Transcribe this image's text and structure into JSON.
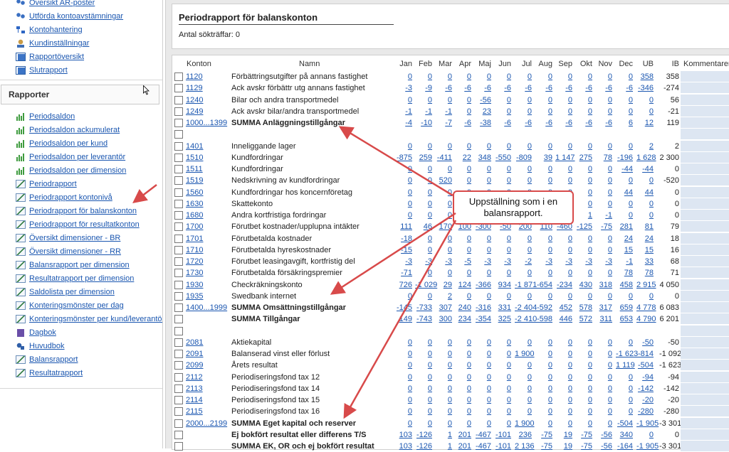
{
  "sidebar": {
    "top_links": [
      {
        "label": "Översikt AR-poster",
        "icon": "people-icon"
      },
      {
        "label": "Utförda kontoavstämningar",
        "icon": "people-icon"
      },
      {
        "label": "Kontohantering",
        "icon": "tree-icon"
      },
      {
        "label": "Kundinställningar",
        "icon": "user-icon"
      },
      {
        "label": "Rapportöversikt",
        "icon": "report-icon"
      },
      {
        "label": "Slutrapport",
        "icon": "report-icon"
      }
    ],
    "reports_heading": "Rapporter",
    "report_links": [
      {
        "label": "Periodsaldon",
        "icon": "bar-chart-icon"
      },
      {
        "label": "Periodsaldon ackumulerat",
        "icon": "bar-chart-icon"
      },
      {
        "label": "Periodsaldon per kund",
        "icon": "bar-chart-icon"
      },
      {
        "label": "Periodsaldon per leverantör",
        "icon": "bar-chart-icon"
      },
      {
        "label": "Periodsaldon per dimension",
        "icon": "bar-chart-icon"
      },
      {
        "label": "Periodrapport",
        "icon": "line-chart-icon"
      },
      {
        "label": "Periodrapport kontonivå",
        "icon": "line-chart-icon"
      },
      {
        "label": "Periodrapport för balanskonton",
        "icon": "line-chart-icon"
      },
      {
        "label": "Periodrapport för resultatkonton",
        "icon": "line-chart-icon"
      },
      {
        "label": "Översikt dimensioner - BR",
        "icon": "line-chart-icon"
      },
      {
        "label": "Översikt dimensioner - RR",
        "icon": "line-chart-icon"
      },
      {
        "label": "Balansrapport per dimension",
        "icon": "line-chart-icon"
      },
      {
        "label": "Resultatrapport per dimension",
        "icon": "line-chart-icon"
      },
      {
        "label": "Saldolista per dimension",
        "icon": "line-chart-icon"
      },
      {
        "label": "Konteringsmönster per dag",
        "icon": "line-chart-icon"
      },
      {
        "label": "Konteringsmönster per kund/leverantör",
        "icon": "line-chart-icon"
      },
      {
        "label": "Dagbok",
        "icon": "journal-icon"
      },
      {
        "label": "Huvudbok",
        "icon": "ledger-icon"
      },
      {
        "label": "Balansrapport",
        "icon": "line-chart-icon"
      },
      {
        "label": "Resultatrapport",
        "icon": "line-chart-icon"
      }
    ]
  },
  "main": {
    "title": "Periodrapport för balanskonton",
    "hits_label": "Antal sökträffar:",
    "hits_value": "0"
  },
  "table": {
    "headers": {
      "konton": "Konton",
      "namn": "Namn",
      "months": [
        "Jan",
        "Feb",
        "Mar",
        "Apr",
        "Maj",
        "Jun",
        "Jul",
        "Aug",
        "Sep",
        "Okt",
        "Nov",
        "Dec",
        "UB"
      ],
      "ib": "IB",
      "kommentarer": "Kommentarer"
    },
    "rows": [
      {
        "konto": "1120",
        "namn": "Förbättringsutgifter på annans fastighet",
        "vals": [
          "0",
          "0",
          "0",
          "0",
          "0",
          "0",
          "0",
          "0",
          "0",
          "0",
          "0",
          "0",
          "358"
        ],
        "ib": "358"
      },
      {
        "konto": "1129",
        "namn": "Ack avskr förbättr utg annans fastighet",
        "vals": [
          "-3",
          "-9",
          "-6",
          "-6",
          "-6",
          "-6",
          "-6",
          "-6",
          "-6",
          "-6",
          "-6",
          "-6",
          "-346"
        ],
        "ib": "-274"
      },
      {
        "konto": "1240",
        "namn": "Bilar och andra transportmedel",
        "vals": [
          "0",
          "0",
          "0",
          "0",
          "-56",
          "0",
          "0",
          "0",
          "0",
          "0",
          "0",
          "0",
          "0"
        ],
        "ib": "56"
      },
      {
        "konto": "1249",
        "namn": "Ack avskr bilar/andra transportmedel",
        "vals": [
          "-1",
          "-1",
          "-1",
          "0",
          "23",
          "0",
          "0",
          "0",
          "0",
          "0",
          "0",
          "0",
          "0"
        ],
        "ib": "-21"
      },
      {
        "konto": "1000...1399",
        "namn": "SUMMA Anläggningstillgångar",
        "bold": true,
        "vals": [
          "-4",
          "-10",
          "-7",
          "-6",
          "-38",
          "-6",
          "-6",
          "-6",
          "-6",
          "-6",
          "-6",
          "6",
          "12"
        ],
        "ib": "119"
      },
      {
        "blank": true
      },
      {
        "konto": "1401",
        "namn": "Inneliggande lager",
        "vals": [
          "0",
          "0",
          "0",
          "0",
          "0",
          "0",
          "0",
          "0",
          "0",
          "0",
          "0",
          "0",
          "2"
        ],
        "ib": "2"
      },
      {
        "konto": "1510",
        "namn": "Kundfordringar",
        "vals": [
          "-875",
          "259",
          "-411",
          "22",
          "348",
          "-550",
          "-809",
          "39",
          "1 147",
          "275",
          "78",
          "-196",
          "1 628"
        ],
        "ib": "2 300"
      },
      {
        "konto": "1511",
        "namn": "Kundfordringar",
        "vals": [
          "0",
          "0",
          "0",
          "0",
          "0",
          "0",
          "0",
          "0",
          "0",
          "0",
          "0",
          "-44",
          "-44"
        ],
        "ib": "0"
      },
      {
        "konto": "1519",
        "namn": "Nedskrivning av kundfordringar",
        "vals": [
          "0",
          "0",
          "520",
          "0",
          "0",
          "0",
          "0",
          "0",
          "0",
          "0",
          "0",
          "0",
          "0"
        ],
        "ib": "-520"
      },
      {
        "konto": "1560",
        "namn": "Kundfordringar hos koncernföretag",
        "vals": [
          "0",
          "0",
          "0",
          "0",
          "0",
          "0",
          "0",
          "0",
          "0",
          "0",
          "0",
          "44",
          "44"
        ],
        "ib": "0"
      },
      {
        "konto": "1630",
        "namn": "Skattekonto",
        "vals": [
          "0",
          "0",
          "0",
          "0",
          "0",
          "0",
          "0",
          "0",
          "0",
          "0",
          "0",
          "0",
          "0"
        ],
        "ib": "0"
      },
      {
        "konto": "1680",
        "namn": "Andra kortfristiga fordringar",
        "vals": [
          "0",
          "0",
          "0",
          "0",
          "0",
          "0",
          "0",
          "0",
          "0",
          "1",
          "-1",
          "0",
          "0"
        ],
        "ib": "0"
      },
      {
        "konto": "1700",
        "namn": "Förutbet kostnader/upplupna intäkter",
        "vals": [
          "111",
          "46",
          "170",
          "100",
          "-300",
          "-50",
          "200",
          "110",
          "-460",
          "-125",
          "-75",
          "281",
          "81"
        ],
        "ib": "79"
      },
      {
        "konto": "1701",
        "namn": "Förutbetalda kostnader",
        "vals": [
          "-18",
          "0",
          "0",
          "0",
          "0",
          "0",
          "0",
          "0",
          "0",
          "0",
          "0",
          "24",
          "24"
        ],
        "ib": "18"
      },
      {
        "konto": "1710",
        "namn": "Förutbetalda hyreskostnader",
        "vals": [
          "-15",
          "0",
          "0",
          "0",
          "0",
          "0",
          "0",
          "0",
          "0",
          "0",
          "0",
          "15",
          "15"
        ],
        "ib": "16"
      },
      {
        "konto": "1720",
        "namn": "Förutbet leasingavgift, kortfristig del",
        "vals": [
          "-3",
          "-3",
          "-3",
          "-5",
          "-3",
          "-3",
          "-2",
          "-3",
          "-3",
          "-3",
          "-3",
          "-1",
          "33"
        ],
        "ib": "68"
      },
      {
        "konto": "1730",
        "namn": "Förutbetalda försäkringspremier",
        "vals": [
          "-71",
          "0",
          "0",
          "0",
          "0",
          "0",
          "0",
          "0",
          "0",
          "0",
          "0",
          "78",
          "78"
        ],
        "ib": "71"
      },
      {
        "konto": "1930",
        "namn": "Checkräkningskonto",
        "vals": [
          "726",
          "-1 029",
          "29",
          "124",
          "-366",
          "934",
          "-1 871",
          "-654",
          "-234",
          "430",
          "318",
          "458",
          "2 915"
        ],
        "ib": "4 050"
      },
      {
        "konto": "1935",
        "namn": "Swedbank internet",
        "vals": [
          "0",
          "0",
          "2",
          "0",
          "0",
          "0",
          "0",
          "0",
          "0",
          "0",
          "0",
          "0",
          "0"
        ],
        "ib": "0"
      },
      {
        "konto": "1400...1999",
        "namn": "SUMMA Omsättningstillgångar",
        "bold": true,
        "vals": [
          "-145",
          "-733",
          "307",
          "240",
          "-316",
          "331",
          "-2 404",
          "-592",
          "452",
          "578",
          "317",
          "659",
          "4 778"
        ],
        "ib": "6 083"
      },
      {
        "konto": "",
        "namn": "SUMMA Tillgångar",
        "bold": true,
        "vals": [
          "149",
          "-743",
          "300",
          "234",
          "-354",
          "325",
          "-2 410",
          "-598",
          "446",
          "572",
          "311",
          "653",
          "4 790"
        ],
        "ib": "6 201"
      },
      {
        "blank": true
      },
      {
        "konto": "2081",
        "namn": "Aktiekapital",
        "vals": [
          "0",
          "0",
          "0",
          "0",
          "0",
          "0",
          "0",
          "0",
          "0",
          "0",
          "0",
          "0",
          "-50"
        ],
        "ib": "-50"
      },
      {
        "konto": "2091",
        "namn": "Balanserad vinst eller förlust",
        "vals": [
          "0",
          "0",
          "0",
          "0",
          "0",
          "0",
          "1 900",
          "0",
          "0",
          "0",
          "0",
          "-1 623",
          "-814"
        ],
        "ib": "-1 092"
      },
      {
        "konto": "2099",
        "namn": "Årets resultat",
        "vals": [
          "0",
          "0",
          "0",
          "0",
          "0",
          "0",
          "0",
          "0",
          "0",
          "0",
          "0",
          "1 119",
          "-504"
        ],
        "ib": "-1 623"
      },
      {
        "konto": "2112",
        "namn": "Periodiseringsfond tax 12",
        "vals": [
          "0",
          "0",
          "0",
          "0",
          "0",
          "0",
          "0",
          "0",
          "0",
          "0",
          "0",
          "0",
          "-94"
        ],
        "ib": "-94"
      },
      {
        "konto": "2113",
        "namn": "Periodiseringsfond tax 14",
        "vals": [
          "0",
          "0",
          "0",
          "0",
          "0",
          "0",
          "0",
          "0",
          "0",
          "0",
          "0",
          "0",
          "-142"
        ],
        "ib": "-142"
      },
      {
        "konto": "2114",
        "namn": "Periodiseringsfond tax 15",
        "vals": [
          "0",
          "0",
          "0",
          "0",
          "0",
          "0",
          "0",
          "0",
          "0",
          "0",
          "0",
          "0",
          "-20"
        ],
        "ib": "-20"
      },
      {
        "konto": "2115",
        "namn": "Periodiseringsfond tax 16",
        "vals": [
          "0",
          "0",
          "0",
          "0",
          "0",
          "0",
          "0",
          "0",
          "0",
          "0",
          "0",
          "0",
          "-280"
        ],
        "ib": "-280"
      },
      {
        "konto": "2000...2199",
        "namn": "SUMMA Eget kapital och reserver",
        "bold": true,
        "vals": [
          "0",
          "0",
          "0",
          "0",
          "0",
          "0",
          "1 900",
          "0",
          "0",
          "0",
          "0",
          "-504",
          "-1 905"
        ],
        "ib": "-3 301"
      },
      {
        "konto": "",
        "namn": "Ej bokfört resultat eller differens T/S",
        "bold": true,
        "vals": [
          "103",
          "-126",
          "1",
          "201",
          "-467",
          "-101",
          "236",
          "-75",
          "19",
          "-75",
          "-56",
          "340",
          "0"
        ],
        "ib": "0"
      },
      {
        "konto": "",
        "namn": "SUMMA EK, OR och ej bokfört resultat",
        "bold": true,
        "vals": [
          "103",
          "-126",
          "1",
          "201",
          "-467",
          "-101",
          "2 136",
          "-75",
          "19",
          "-75",
          "-56",
          "-164",
          "-1 905"
        ],
        "ib": "-3 301"
      }
    ]
  },
  "callout": {
    "line1": "Uppställning som i en",
    "line2": "balansrapport."
  },
  "colors": {
    "link": "#1a56b0",
    "annotation": "#d84a4a",
    "comment_cell": "#dde6f2"
  }
}
